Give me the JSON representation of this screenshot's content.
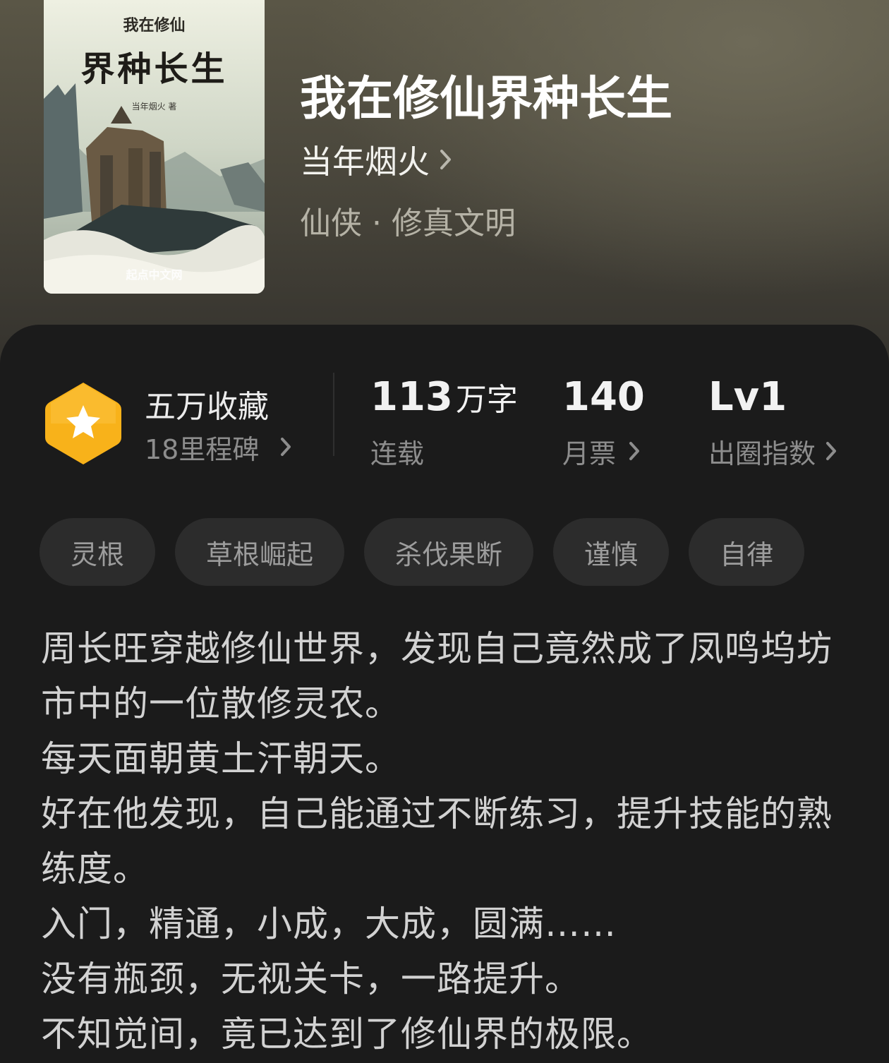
{
  "book": {
    "title": "我在修仙界种长生",
    "author": "当年烟火",
    "genre": "仙侠 · 修真文明",
    "cover": {
      "small_title": "我在修仙",
      "main_title": "界种长生",
      "author_line": "当年烟火 著",
      "publisher": "起点中文网"
    }
  },
  "stats": {
    "collection": {
      "main": "五万收藏",
      "sub": "18里程碑"
    },
    "words": {
      "number": "113",
      "unit": "万字",
      "label": "连载"
    },
    "monthly_votes": {
      "number": "140",
      "label": "月票"
    },
    "circle_index": {
      "number": "Lv1",
      "label": "出圈指数"
    }
  },
  "tags": [
    "灵根",
    "草根崛起",
    "杀伐果断",
    "谨慎",
    "自律"
  ],
  "synopsis": [
    "周长旺穿越修仙世界，发现自己竟然成了凤鸣坞坊市中的一位散修灵农。",
    "每天面朝黄土汗朝天。",
    "好在他发现，自己能通过不断练习，提升技能的熟练度。",
    "入门，精通，小成，大成，圆满……",
    "没有瓶颈，无视关卡，一路提升。",
    "不知觉间，竟已达到了修仙界的极限。"
  ],
  "icons": {
    "badge": "star-hexagon-icon",
    "chevron": "chevron-right-icon"
  },
  "colors": {
    "badge_orange": "#f8b21a",
    "panel_bg": "#1b1b1b",
    "tag_bg": "#2c2c2c"
  }
}
